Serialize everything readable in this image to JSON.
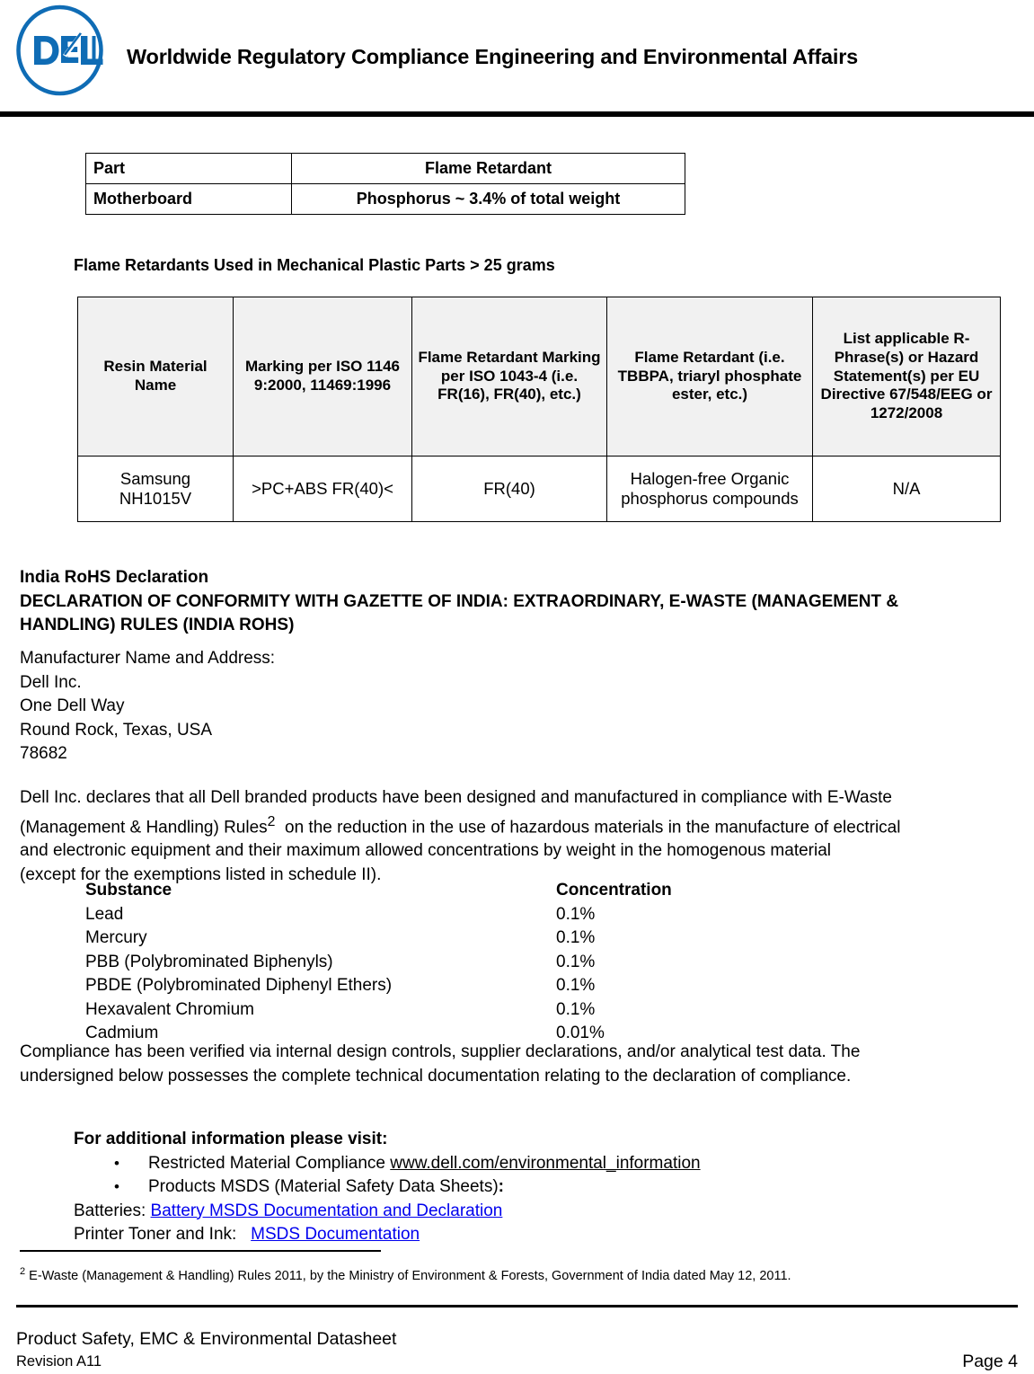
{
  "header": {
    "logo_name": "dell-logo",
    "logo_text": "DELL",
    "logo_color": "#0f6cb5",
    "title": "Worldwide Regulatory Compliance Engineering and Environmental Affairs"
  },
  "part_table": {
    "headers": [
      "Part",
      "Flame Retardant"
    ],
    "rows": [
      [
        "Motherboard",
        "Phosphorus ~ 3.4% of total weight"
      ]
    ]
  },
  "mechanical_section": {
    "heading": "Flame Retardants Used in Mechanical Plastic Parts > 25 grams"
  },
  "resin_table": {
    "headers": [
      "Resin Material Name",
      "Marking per ISO 1146 9:2000, 11469:1996",
      "Flame Retardant Marking per ISO 1043-4 (i.e. FR(16), FR(40), etc.)",
      "Flame Retardant (i.e. TBBPA, triaryl phosphate ester, etc.)",
      "List applicable R-Phrase(s) or Hazard Statement(s) per EU Directive 67/548/EEG or 1272/2008"
    ],
    "rows": [
      {
        "resin_material_name": "Samsung NH1015V",
        "marking_iso": ">PC+ABS FR(40)<",
        "fr_marking": "FR(40)",
        "flame_retardant": "Halogen-free Organic phosphorus compounds",
        "r_phrase": "N/A"
      }
    ],
    "header_bg": "#f1f1f1"
  },
  "india_rohs": {
    "heading": "India RoHS Declaration",
    "subheading_line1": "DECLARATION OF CONFORMITY WITH GAZETTE OF INDIA: EXTRAORDINARY, E-WASTE (MANAGEMENT &",
    "subheading_line2": "HANDLING) RULES (INDIA ROHS)"
  },
  "manufacturer": {
    "label": "Manufacturer Name and Address:",
    "line1": "Dell Inc.",
    "line2": "One Dell Way",
    "line3": "Round Rock, Texas, USA",
    "line4": "78682"
  },
  "declaration": {
    "line1": "Dell Inc. declares that all Dell branded products have been designed and manufactured in compliance with  E-Waste",
    "line2_a": "(Management & Handling) Rules",
    "line2_sup": "2",
    "line2_b": "  on the reduction in the use of hazardous materials in the manufacture of electrical",
    "line3": "and electronic equipment and their  maximum allowed concentrations by weight  in the homogenous material",
    "line4": "(except for the exemptions listed in schedule II)."
  },
  "substances": {
    "col_headers": [
      "Substance",
      "Concentration"
    ],
    "rows": [
      {
        "name": "Lead",
        "concentration": "0.1%"
      },
      {
        "name": "Mercury",
        "concentration": "0.1%"
      },
      {
        "name": "PBB (Polybrominated Biphenyls)",
        "concentration": "0.1%"
      },
      {
        "name": "PBDE (Polybrominated Diphenyl Ethers)",
        "concentration": "0.1%"
      },
      {
        "name": "Hexavalent Chromium",
        "concentration": "0.1%"
      },
      {
        "name": "Cadmium",
        "concentration": "0.01%"
      }
    ]
  },
  "compliance": {
    "line1": "Compliance has been verified via internal design controls, supplier declarations, and/or analytical test data. The",
    "line2": "undersigned below possesses the complete technical documentation relating to the declaration of compliance."
  },
  "additional_info": {
    "title": "For additional information please visit:",
    "bullet_symbol": "•",
    "bullet1_text": "Restricted Material Compliance ",
    "bullet1_link": "www.dell.com/environmental_information",
    "bullet2_text": "Products MSDS (Material Safety Data Sheets)",
    "bullet2_colon": ":",
    "batteries_label": "Batteries: ",
    "batteries_link": "Battery MSDS Documentation and Declaration",
    "printer_label": "Printer Toner and Ink:   ",
    "printer_link": "MSDS Documentation",
    "link_color": "#0000ee"
  },
  "footnote": {
    "marker": "2",
    "text": " E-Waste (Management & Handling) Rules 2011, by the Ministry of Environment & Forests, Government of India dated May 12, 2011."
  },
  "footer": {
    "title": "Product Safety, EMC & Environmental Datasheet",
    "revision": "Revision A11",
    "page": "Page 4"
  }
}
